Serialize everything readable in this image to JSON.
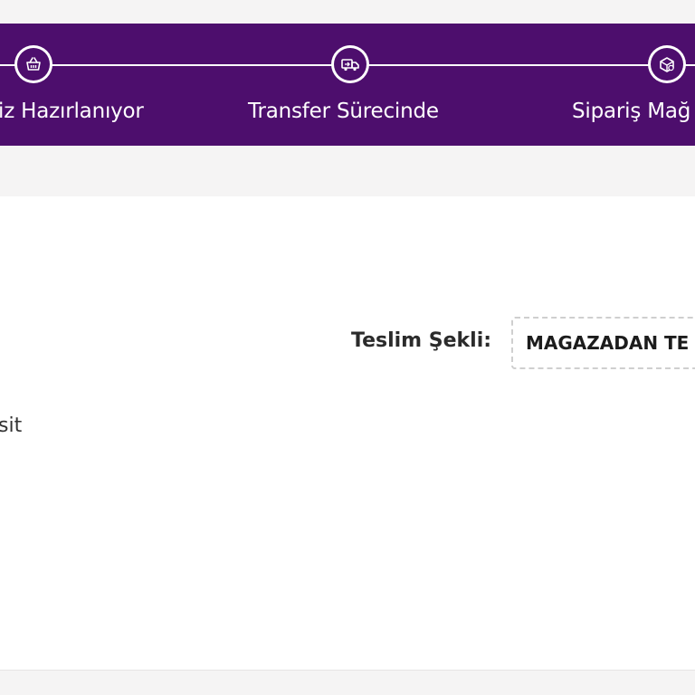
{
  "tracker": {
    "steps": [
      {
        "label": "iz Hazırlanıyor",
        "icon": "basket-icon"
      },
      {
        "label": "Transfer Sürecinde",
        "icon": "transfer-truck-icon"
      },
      {
        "label": "Sipariş Mağ",
        "icon": "store-package-icon"
      }
    ],
    "colors": {
      "background": "#4d0e6d",
      "line": "#ffffff"
    }
  },
  "delivery": {
    "label": "Teslim Şekli:",
    "value": "MAGAZADAN TE"
  },
  "partial_text": "sit"
}
